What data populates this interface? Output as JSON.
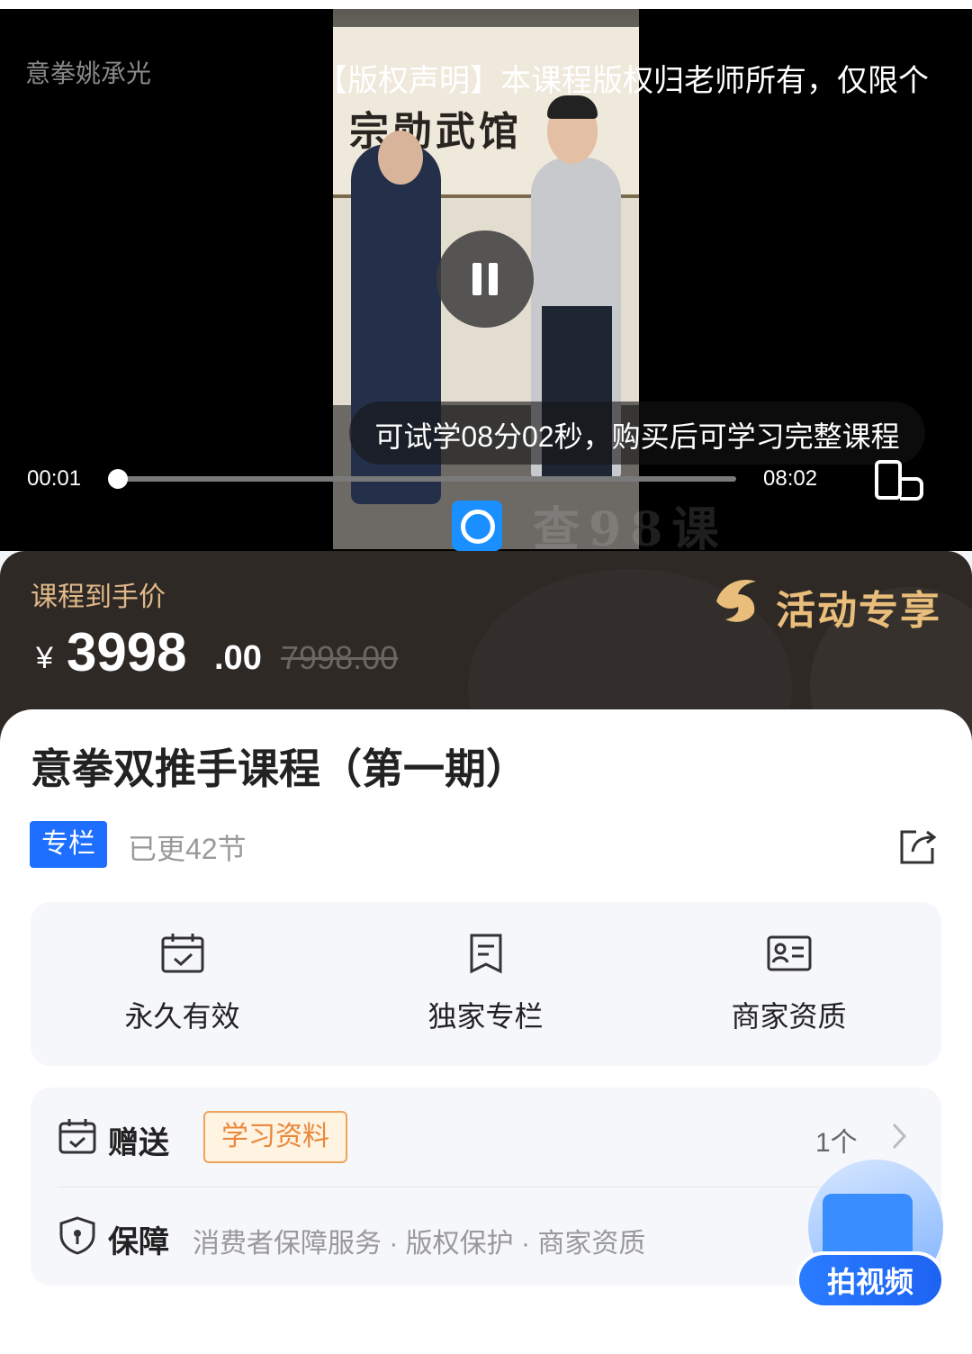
{
  "player": {
    "channel_name": "意拳姚承光",
    "copyright_notice": "【版权声明】本课程版权归老师所有，仅限个人",
    "banner_text": "宗勋武馆",
    "trial_notice": "可试学08分02秒，购买后可学习完整课程",
    "current_time": "00:01",
    "total_time": "08:02",
    "progress_fraction": 0.002,
    "watermark_text": "查98课"
  },
  "price": {
    "label": "课程到手价",
    "currency": "¥",
    "integer": "3998",
    "decimal": ".00",
    "original": "7998.00",
    "activity": "活动专享"
  },
  "course": {
    "title": "意拳双推手课程（第一期）",
    "tag": "专栏",
    "updated": "已更42节"
  },
  "features": [
    {
      "icon": "calendar-check-icon",
      "label": "永久有效"
    },
    {
      "icon": "document-icon",
      "label": "独家专栏"
    },
    {
      "icon": "id-card-icon",
      "label": "商家资质"
    }
  ],
  "service": {
    "gift_title": "赠送",
    "gift_tag": "学习资料",
    "gift_count": "1个",
    "guarantee_title": "保障",
    "guarantee_items": "消费者保障服务 · 版权保护 · 商家资质"
  },
  "float_button": {
    "label": "拍视频"
  },
  "colors": {
    "accent_blue": "#1e6fff",
    "price_gold": "#e0b98a",
    "gift_orange": "#f0a25a"
  }
}
